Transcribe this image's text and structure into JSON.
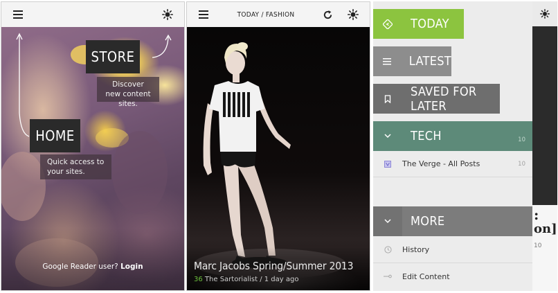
{
  "panel1": {
    "store": {
      "title": "STORE",
      "description": "Discover new content sites."
    },
    "home": {
      "title": "HOME",
      "description": "Quick access to your sites."
    },
    "login_prompt": "Google Reader user?",
    "login_link": "Login"
  },
  "panel2": {
    "title": "TODAY / FASHION",
    "article": {
      "headline": "Marc Jacobs Spring/Summer 2013",
      "count": "36",
      "source": "The Sartorialist",
      "time": " / 1 day ago"
    }
  },
  "panel3": {
    "nav": {
      "today": "TODAY",
      "latest": "LATEST",
      "saved": "SAVED FOR LATER",
      "tech": "TECH",
      "tech_count": "10",
      "more": "MORE"
    },
    "feeds": [
      {
        "label": "The Verge - All Posts",
        "count": "10"
      }
    ],
    "more_items": [
      {
        "label": "History"
      },
      {
        "label": "Edit Content"
      }
    ],
    "peek": {
      "line1": ":",
      "line2": "on]"
    }
  },
  "colors": {
    "today_green": "#8cc43f",
    "tech_teal": "#5d8a79",
    "count_green": "#6cbf3c",
    "callout_dark": "#2a2a2a"
  }
}
